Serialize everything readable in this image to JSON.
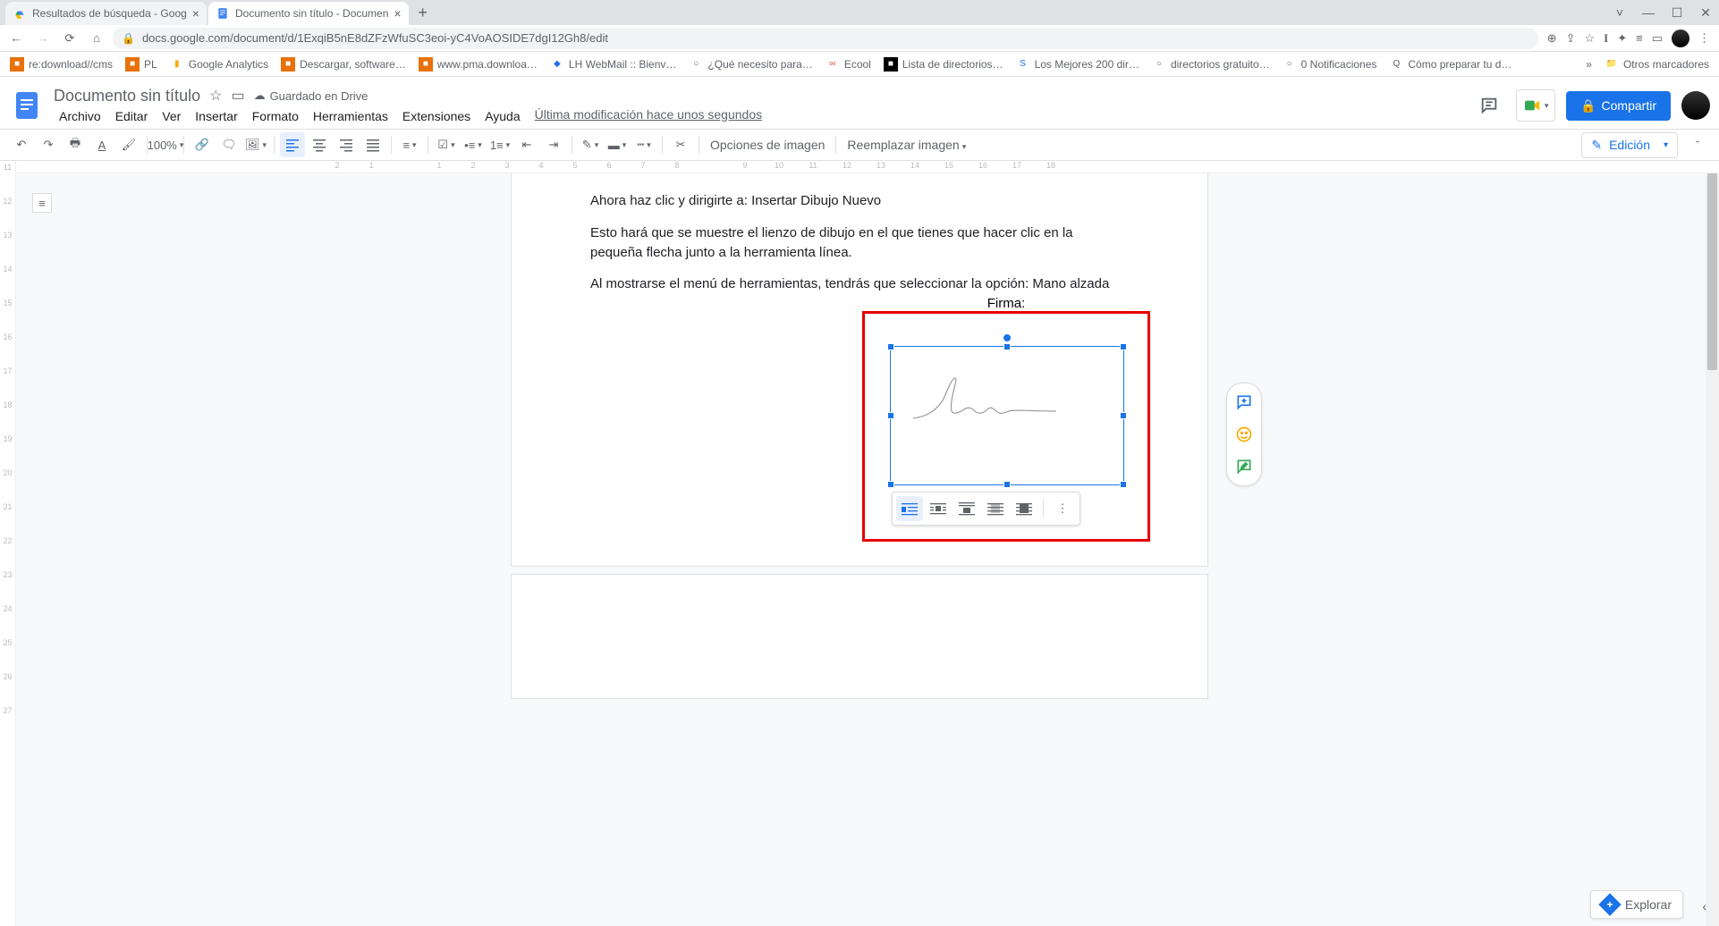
{
  "browser": {
    "tabs": [
      {
        "title": "Resultados de búsqueda - Goog"
      },
      {
        "title": "Documento sin título - Documen"
      }
    ],
    "url": "docs.google.com/document/d/1ExqiB5nE8dZFzWfuSC3eoi-yC4VoAOSIDE7dgI12Gh8/edit"
  },
  "bookmarks": [
    {
      "label": "re:download//cms"
    },
    {
      "label": "PL"
    },
    {
      "label": "Google Analytics"
    },
    {
      "label": "Descargar, software…"
    },
    {
      "label": "www.pma.downloa…"
    },
    {
      "label": "LH WebMail :: Bienv…"
    },
    {
      "label": "¿Qué necesito para…"
    },
    {
      "label": "Ecool"
    },
    {
      "label": "Lista de directorios…"
    },
    {
      "label": "Los Mejores 200 dir…"
    },
    {
      "label": "directorios gratuito…"
    },
    {
      "label": "0 Notificaciones"
    },
    {
      "label": "Cómo preparar tu d…"
    },
    {
      "label": "Otros marcadores"
    }
  ],
  "doc": {
    "title": "Documento sin título",
    "saved": "Guardado en Drive",
    "menus": [
      "Archivo",
      "Editar",
      "Ver",
      "Insertar",
      "Formato",
      "Herramientas",
      "Extensiones",
      "Ayuda"
    ],
    "lastmod": "Última modificación hace unos segundos",
    "share": "Compartir"
  },
  "toolbar": {
    "zoom": "100%",
    "image_options": "Opciones de imagen",
    "replace_image": "Reemplazar imagen",
    "editing": "Edición"
  },
  "ruler": {
    "h": [
      2,
      1,
      "",
      1,
      2,
      3,
      4,
      5,
      6,
      7,
      8,
      "",
      9,
      10,
      11,
      12,
      13,
      14,
      15,
      16,
      17,
      18
    ],
    "v": [
      11,
      12,
      13,
      14,
      15,
      16,
      17,
      18,
      19,
      20,
      21,
      22,
      23,
      24,
      25,
      26,
      27
    ]
  },
  "body": {
    "p1": "Ahora haz clic y dirigirte a: Insertar Dibujo Nuevo",
    "p2": "Esto hará que se muestre el lienzo de dibujo en el que tienes que hacer clic en la pequeña flecha junto a la herramienta línea.",
    "p3": "Al mostrarse el menú de herramientas, tendrás que seleccionar la opción: Mano alzada",
    "firma": "Firma:"
  },
  "explore": "Explorar"
}
